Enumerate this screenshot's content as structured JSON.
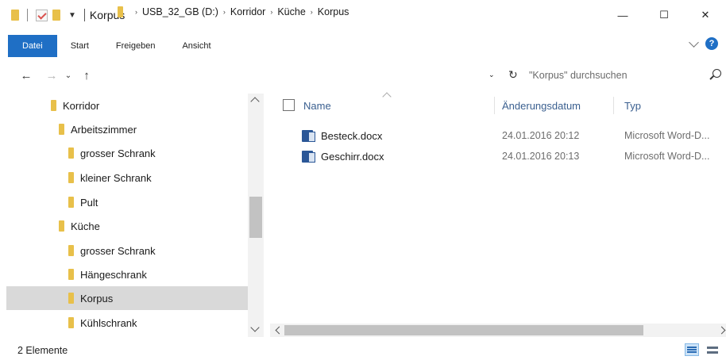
{
  "window": {
    "title": "Korpus",
    "controls": {
      "minimize": "—",
      "maximize": "☐",
      "close": "✕"
    }
  },
  "ribbon": {
    "tabs": [
      {
        "label": "Datei"
      },
      {
        "label": "Start"
      },
      {
        "label": "Freigeben"
      },
      {
        "label": "Ansicht"
      }
    ],
    "help_label": "?"
  },
  "address": {
    "back": "←",
    "forward": "→",
    "recent": "⌄",
    "up": "↑",
    "breadcrumb": [
      {
        "label": "USB_32_GB (D:)"
      },
      {
        "label": "Korridor"
      },
      {
        "label": "Küche"
      },
      {
        "label": "Korpus"
      }
    ],
    "crumb_sep": "›",
    "dropdown": "⌄",
    "refresh": "↻"
  },
  "search": {
    "placeholder": "\"Korpus\" durchsuchen"
  },
  "navigation": {
    "items": [
      {
        "label": "Korridor"
      },
      {
        "label": "Arbeitszimmer"
      },
      {
        "label": "grosser Schrank"
      },
      {
        "label": "kleiner Schrank"
      },
      {
        "label": "Pult"
      },
      {
        "label": "Küche"
      },
      {
        "label": "grosser Schrank"
      },
      {
        "label": "Hängeschrank"
      },
      {
        "label": "Korpus",
        "selected": true
      },
      {
        "label": "Kühlschrank"
      }
    ]
  },
  "file_list": {
    "columns": {
      "name": "Name",
      "date": "Änderungsdatum",
      "type": "Typ"
    },
    "rows": [
      {
        "name": "Besteck.docx",
        "date": "24.01.2016 20:12",
        "type": "Microsoft Word-D..."
      },
      {
        "name": "Geschirr.docx",
        "date": "24.01.2016 20:13",
        "type": "Microsoft Word-D..."
      }
    ]
  },
  "status": {
    "count": "2 Elemente"
  },
  "colors": {
    "accent": "#1f6fc5",
    "selection": "#d9d9d9",
    "folder": "#e8c04a",
    "word": "#2b5797",
    "header_text": "#3a5f8f"
  },
  "icons": [
    "folder-icon",
    "check-icon",
    "word-document-icon",
    "search-icon",
    "refresh-icon",
    "help-icon"
  ]
}
